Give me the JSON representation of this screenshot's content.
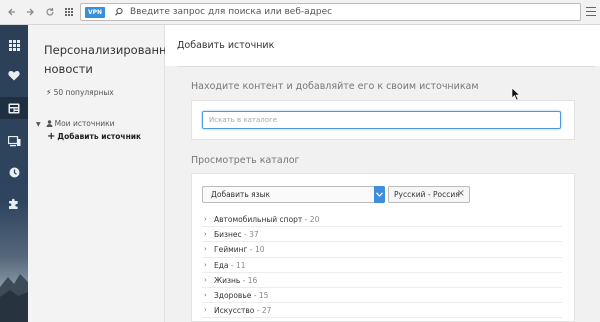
{
  "toolbar": {
    "vpn_label": "VPN",
    "address_placeholder": "Введите запрос для поиска или веб-адрес"
  },
  "sidebar_icons": [
    "apps-icon",
    "heart-icon",
    "news-icon",
    "devices-icon",
    "clock-icon",
    "puzzle-icon"
  ],
  "nav": {
    "title": "Персонализированные новости",
    "popular": "50 популярных",
    "my_sources": "Мои источники",
    "add_source": "Добавить источник"
  },
  "main": {
    "page_title": "Добавить источник",
    "find_title": "Находите контент и добавляйте его к своим источникам",
    "search_placeholder": "Искать в каталоге",
    "browse_title": "Просмотреть каталог",
    "add_language": "Добавить язык",
    "selected_language": "Русский - Россия",
    "categories": [
      {
        "name": "Автомобильный спорт",
        "count": "20"
      },
      {
        "name": "Бизнес",
        "count": "37"
      },
      {
        "name": "Гейминг",
        "count": "10"
      },
      {
        "name": "Еда",
        "count": "11"
      },
      {
        "name": "Жизнь",
        "count": "16"
      },
      {
        "name": "Здоровье",
        "count": "15"
      },
      {
        "name": "Искусство",
        "count": "27"
      }
    ]
  },
  "colors": {
    "accent": "#3d8ede",
    "sidebar": "#2b3f57"
  }
}
